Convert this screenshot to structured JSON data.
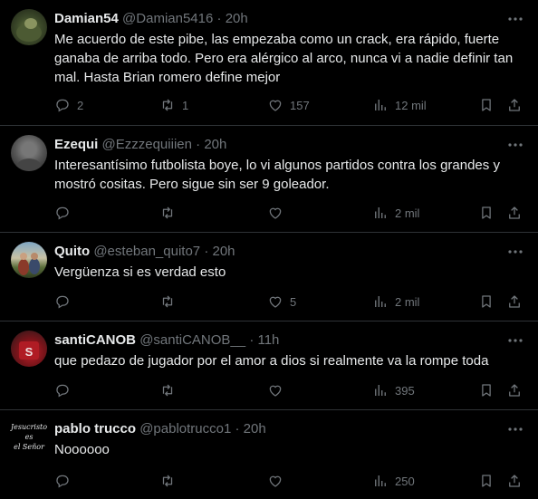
{
  "tweets": [
    {
      "name": "Damian54",
      "handle": "@Damian5416",
      "time": "20h",
      "text": "Me acuerdo de este pibe, las empezaba como un crack, era rápido, fuerte ganaba de arriba todo. Pero era alérgico al arco, nunca vi a nadie definir tan mal. Hasta Brian romero define mejor",
      "replies": "2",
      "reposts": "1",
      "likes": "157",
      "views": "12 mil"
    },
    {
      "name": "Ezequi",
      "handle": "@Ezzzequiiien",
      "time": "20h",
      "text": "Interesantísimo futbolista boye, lo vi algunos partidos contra los grandes y mostró cositas. Pero sigue sin ser 9 goleador.",
      "replies": "",
      "reposts": "",
      "likes": "",
      "views": "2 mil"
    },
    {
      "name": "Quito",
      "handle": "@esteban_quito7",
      "time": "20h",
      "text": "Vergüenza si es verdad esto",
      "replies": "",
      "reposts": "",
      "likes": "5",
      "views": "2 mil"
    },
    {
      "name": "santiCANOB",
      "handle": "@santiCANOB__",
      "time": "11h",
      "text": "que pedazo de jugador por el amor a dios si realmente va la rompe toda",
      "replies": "",
      "reposts": "",
      "likes": "",
      "views": "395"
    },
    {
      "name": "pablo trucco",
      "handle": "@pablotrucco1",
      "time": "20h",
      "text": "Noooooo",
      "replies": "",
      "reposts": "",
      "likes": "",
      "views": "250",
      "avatar_text": [
        "Jesucristo",
        "es",
        "el Señor"
      ]
    }
  ],
  "icons": {
    "more": "more-icon",
    "reply": "reply-icon",
    "repost": "repost-icon",
    "like": "like-icon",
    "views": "views-icon",
    "bookmark": "bookmark-icon",
    "share": "share-icon"
  },
  "colors": {
    "background": "#000000",
    "text": "#e7e9ea",
    "secondary": "#71767b",
    "divider": "#2f3336"
  }
}
